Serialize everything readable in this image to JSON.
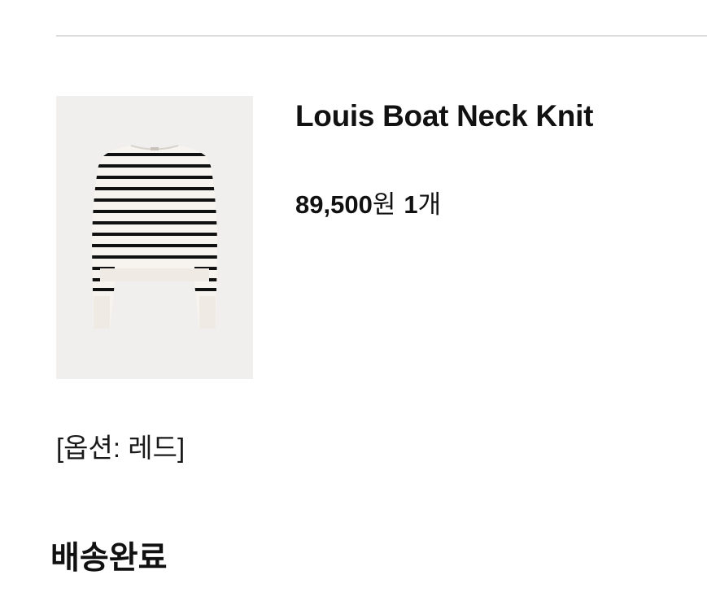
{
  "order_item": {
    "product_name": "Louis Boat Neck Knit",
    "price_amount": "89,500",
    "price_unit": "원",
    "quantity_number": "1",
    "quantity_unit": "개",
    "option_text": "[옵션: 레드]",
    "image_icon": "striped-sweater-image"
  },
  "delivery": {
    "status_label": "배송완료"
  },
  "colors": {
    "divider": "#dcdcdc",
    "image_background": "#f0efee",
    "stripe": "#111111",
    "knit": "#f7f4ef"
  }
}
